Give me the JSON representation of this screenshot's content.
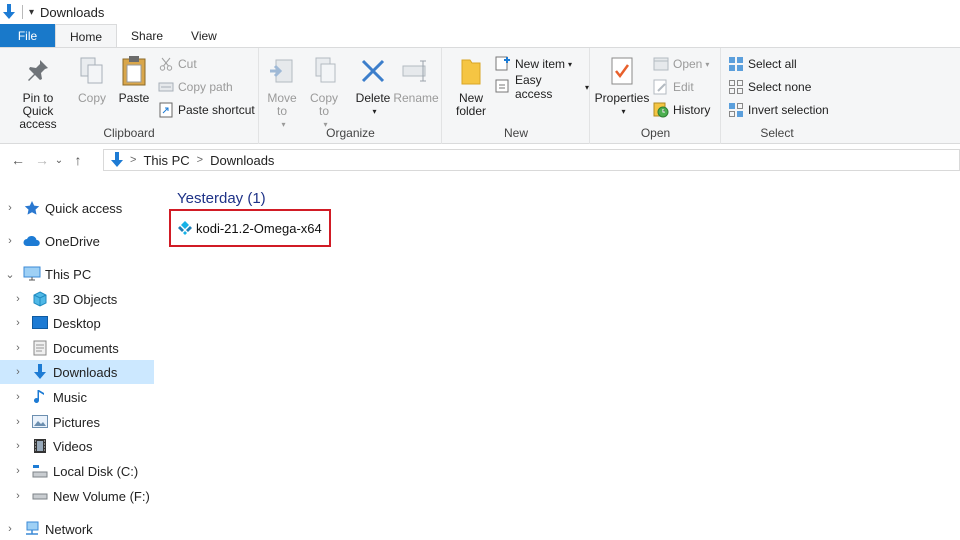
{
  "window": {
    "title": "Downloads"
  },
  "tabs": [
    "File",
    "Home",
    "Share",
    "View"
  ],
  "ribbon": {
    "clipboard": {
      "label": "Clipboard",
      "pin": "Pin to Quick access",
      "copy": "Copy",
      "paste": "Paste",
      "cut": "Cut",
      "copy_path": "Copy path",
      "paste_shortcut": "Paste shortcut"
    },
    "organize": {
      "label": "Organize",
      "move_to": "Move to",
      "copy_to": "Copy to",
      "delete": "Delete",
      "rename": "Rename"
    },
    "new": {
      "label": "New",
      "new_folder": "New folder",
      "new_item": "New item",
      "easy_access": "Easy access"
    },
    "open": {
      "label": "Open",
      "properties": "Properties",
      "open": "Open",
      "edit": "Edit",
      "history": "History"
    },
    "select": {
      "label": "Select",
      "select_all": "Select all",
      "select_none": "Select none",
      "invert": "Invert selection"
    }
  },
  "address": {
    "crumbs": [
      "This PC",
      "Downloads"
    ]
  },
  "nav_pane": {
    "quick_access": "Quick access",
    "onedrive": "OneDrive",
    "this_pc": "This PC",
    "objects3d": "3D Objects",
    "desktop": "Desktop",
    "documents": "Documents",
    "downloads": "Downloads",
    "music": "Music",
    "pictures": "Pictures",
    "videos": "Videos",
    "local_disk": "Local Disk (C:)",
    "new_volume": "New Volume (F:)",
    "network": "Network"
  },
  "content": {
    "group_header": "Yesterday (1)",
    "file_name": "kodi-21.2-Omega-x64"
  },
  "colors": {
    "accent": "#1979ca",
    "selection": "#cce8ff",
    "highlight_border": "#d11b25",
    "group_header": "#1e3287"
  }
}
